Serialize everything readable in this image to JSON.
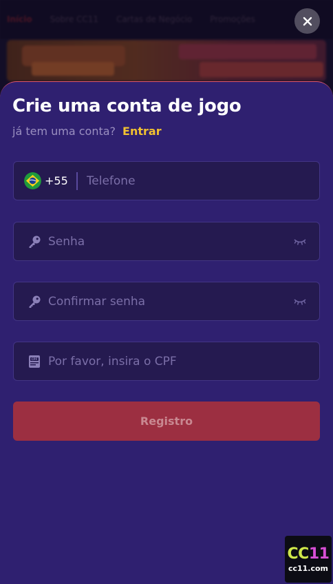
{
  "background": {
    "nav_items": [
      "Início",
      "Sobre CC11",
      "Cartas de Negócio",
      "Promoções"
    ],
    "banner": {
      "headline": "",
      "subline": ""
    }
  },
  "modal": {
    "title": "Crie uma conta de jogo",
    "subtitle_text": "já tem uma conta?",
    "login_link": "Entrar",
    "close_icon": "close-icon",
    "phone": {
      "flag_icon": "brazil-flag-icon",
      "country_code": "+55",
      "placeholder": "Telefone",
      "value": ""
    },
    "password": {
      "icon": "key-icon",
      "placeholder": "Senha",
      "value": "",
      "toggle_icon": "eye-closed-icon"
    },
    "confirm_password": {
      "icon": "key-icon",
      "placeholder": "Confirmar senha",
      "value": "",
      "toggle_icon": "eye-closed-icon"
    },
    "cpf": {
      "icon": "cpf-card-icon",
      "placeholder": "Por favor, insira o CPF",
      "value": ""
    },
    "register_button": "Registro"
  },
  "watermark": {
    "main_prefix": "CC",
    "main_suffix": "11",
    "domain": "cc11.com"
  },
  "colors": {
    "sheet_bg": "#2f2070",
    "field_bg": "#251a50",
    "field_border": "#433585",
    "accent_yellow": "#f2c230",
    "register_bg": "#9c2f41",
    "sheet_top_border": "#e0566a"
  }
}
